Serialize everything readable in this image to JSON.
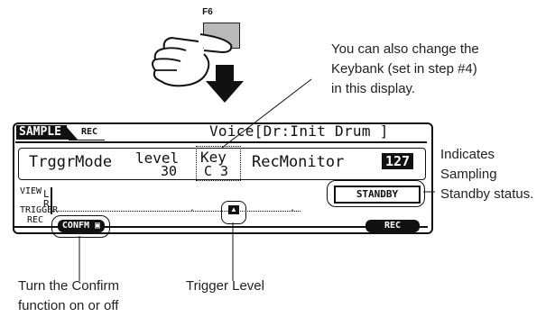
{
  "fkey": {
    "label": "F6"
  },
  "callout_top": {
    "line1": "You can also change the",
    "line2": "Keybank (set in step #4)",
    "line3": "in this display."
  },
  "lcd": {
    "tab_sample": "SAMPLE",
    "tab_rec": "REC",
    "voice": "Voice[Dr:Init Drum ]",
    "trigger_mode": "TrggrMode",
    "level_label": "level",
    "level_value": "30",
    "key_label": "Key",
    "key_value": "C 3",
    "rec_monitor_label": "RecMonitor",
    "rec_monitor_value": "127",
    "view_label": "VIEW",
    "meter_l": "L",
    "meter_r": "R",
    "trigger_label": "TRIGGER",
    "rec_label": "REC",
    "standby": "STANDBY",
    "confm": "CONFM",
    "rec_button": "REC",
    "tick": "."
  },
  "callout_right": {
    "line1": "Indicates",
    "line2": "Sampling",
    "line3": "Standby status."
  },
  "callout_bottom_left": {
    "line1": "Turn the Confirm",
    "line2": "function on or off"
  },
  "callout_bottom_mid": {
    "line1": "Trigger Level"
  }
}
